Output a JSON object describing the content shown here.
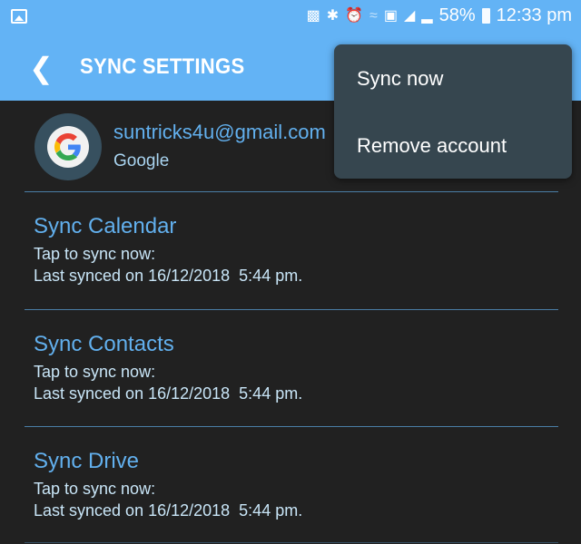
{
  "status_bar": {
    "left_icon": "image-icon",
    "icons": [
      "battery-saver-icon",
      "bluetooth-icon",
      "alarm-icon",
      "wifi-icon",
      "nfc-icon",
      "signal-box-icon",
      "signal-icon"
    ],
    "battery_percent": "58%",
    "time": "12:33 pm"
  },
  "app_bar": {
    "back_icon": "chevron-left-icon",
    "title": "SYNC SETTINGS"
  },
  "account": {
    "email": "suntricks4u@gmail.com",
    "provider": "Google",
    "icon": "google-icon"
  },
  "sync_items": [
    {
      "name": "Sync Calendar",
      "line1": "Tap to sync now:",
      "line2": "Last synced on 16/12/2018  5:44 pm."
    },
    {
      "name": "Sync Contacts",
      "line1": "Tap to sync now:",
      "line2": "Last synced on 16/12/2018  5:44 pm."
    },
    {
      "name": "Sync Drive",
      "line1": "Tap to sync now:",
      "line2": "Last synced on 16/12/2018  5:44 pm."
    }
  ],
  "menu": {
    "items": [
      "Sync now",
      "Remove account"
    ]
  },
  "colors": {
    "accent": "#63b3f5",
    "background": "#212121",
    "menu": "#36464f",
    "link": "#62b0ee"
  }
}
